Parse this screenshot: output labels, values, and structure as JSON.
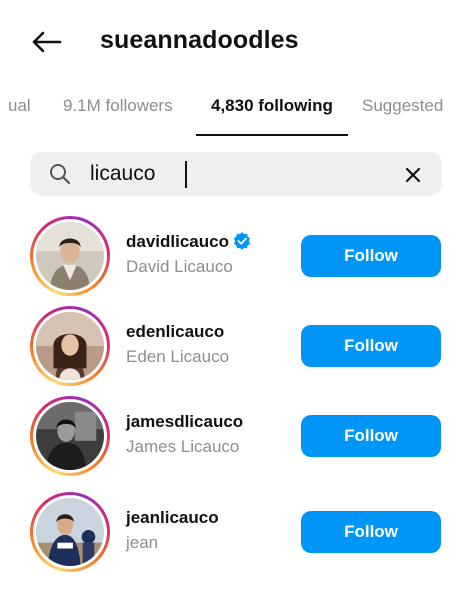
{
  "header": {
    "title": "sueannadoodles",
    "back_icon": "arrow-left-icon"
  },
  "tabs": [
    {
      "label": "ual",
      "active": false
    },
    {
      "label": "9.1M followers",
      "active": false
    },
    {
      "label": "4,830 following",
      "active": true
    },
    {
      "label": "Suggested",
      "active": false
    }
  ],
  "search": {
    "value": "licauco",
    "search_icon": "search-icon",
    "clear_icon": "close-icon"
  },
  "results": [
    {
      "username": "davidlicauco",
      "fullname": "David Licauco",
      "verified": true,
      "button": "Follow"
    },
    {
      "username": "edenlicauco",
      "fullname": "Eden Licauco",
      "verified": false,
      "button": "Follow"
    },
    {
      "username": "jamesdlicauco",
      "fullname": "James Licauco",
      "verified": false,
      "button": "Follow"
    },
    {
      "username": "jeanlicauco",
      "fullname": "jean",
      "verified": false,
      "button": "Follow"
    }
  ],
  "colors": {
    "accent": "#0095f6",
    "secondary_text": "#8e8e8e",
    "search_bg": "#efefef",
    "verified_badge": "#0095f6"
  }
}
